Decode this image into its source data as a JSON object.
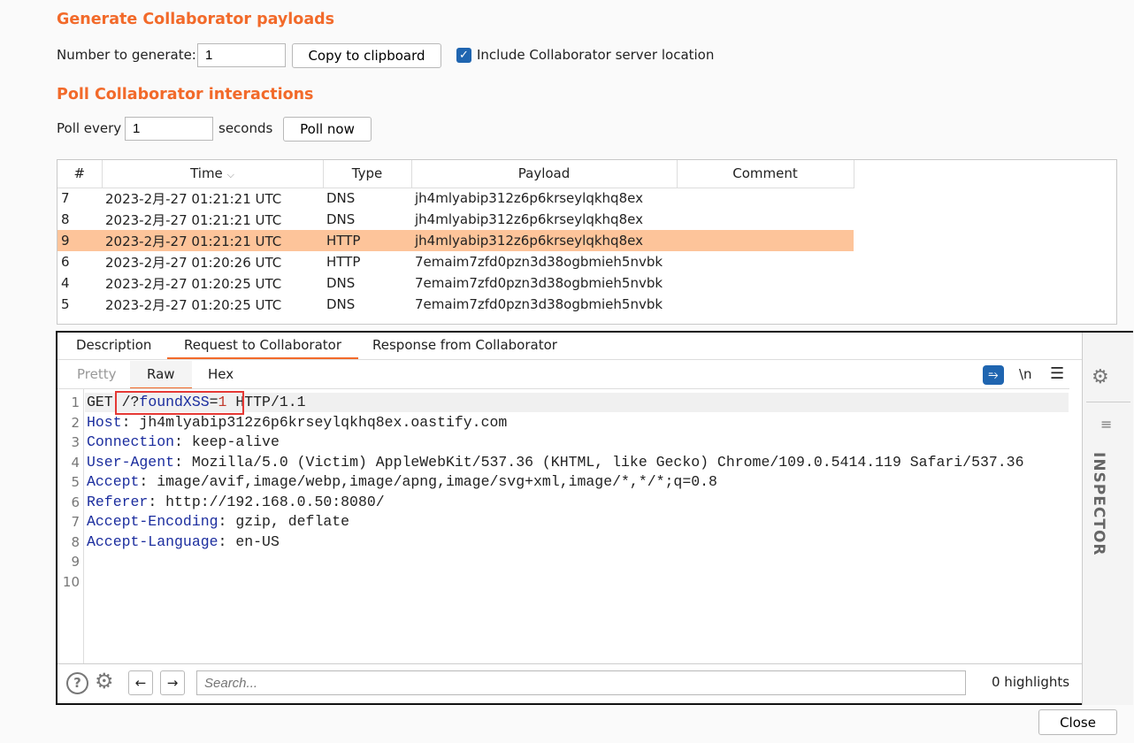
{
  "generate": {
    "title": "Generate Collaborator payloads",
    "number_label": "Number to generate:",
    "number_value": "1",
    "copy_button": "Copy to clipboard",
    "include_label": "Include Collaborator server location",
    "include_checked": true
  },
  "poll": {
    "title": "Poll Collaborator interactions",
    "every_label": "Poll every",
    "every_value": "1",
    "seconds_label": "seconds",
    "poll_now": "Poll now"
  },
  "table": {
    "columns": [
      "#",
      "Time",
      "Type",
      "Payload",
      "Comment"
    ],
    "sort_indicator": "chevron-down-icon",
    "rows": [
      {
        "num": "7",
        "time": "2023-2月-27 01:21:21 UTC",
        "type": "DNS",
        "payload": "jh4mlyabip312z6p6krseylqkhq8ex",
        "comment": "",
        "selected": false
      },
      {
        "num": "8",
        "time": "2023-2月-27 01:21:21 UTC",
        "type": "DNS",
        "payload": "jh4mlyabip312z6p6krseylqkhq8ex",
        "comment": "",
        "selected": false
      },
      {
        "num": "9",
        "time": "2023-2月-27 01:21:21 UTC",
        "type": "HTTP",
        "payload": "jh4mlyabip312z6p6krseylqkhq8ex",
        "comment": "",
        "selected": true
      },
      {
        "num": "6",
        "time": "2023-2月-27 01:20:26 UTC",
        "type": "HTTP",
        "payload": "7emaim7zfd0pzn3d38ogbmieh5nvbk",
        "comment": "",
        "selected": false
      },
      {
        "num": "4",
        "time": "2023-2月-27 01:20:25 UTC",
        "type": "DNS",
        "payload": "7emaim7zfd0pzn3d38ogbmieh5nvbk",
        "comment": "",
        "selected": false
      },
      {
        "num": "5",
        "time": "2023-2月-27 01:20:25 UTC",
        "type": "DNS",
        "payload": "7emaim7zfd0pzn3d38ogbmieh5nvbk",
        "comment": "",
        "selected": false
      }
    ]
  },
  "tabs": [
    "Description",
    "Request to Collaborator",
    "Response from Collaborator"
  ],
  "active_tab": "Request to Collaborator",
  "subtabs": [
    "Pretty",
    "Raw",
    "Hex"
  ],
  "active_subtab": "Raw",
  "toolbar": {
    "newline_label": "\\n"
  },
  "request": {
    "lines": [
      {
        "n": "1",
        "parts": [
          [
            "GET ",
            ""
          ],
          [
            "/?",
            ""
          ],
          [
            "foundXSS",
            "k"
          ],
          [
            "=",
            ""
          ],
          [
            "1",
            "r"
          ],
          [
            " HTTP/1.1",
            ""
          ]
        ]
      },
      {
        "n": "2",
        "parts": [
          [
            "Host",
            "k"
          ],
          [
            ": jh4mlyabip312z6p6krseylqkhq8ex.oastify.com",
            ""
          ]
        ]
      },
      {
        "n": "3",
        "parts": [
          [
            "Connection",
            "k"
          ],
          [
            ": keep-alive",
            ""
          ]
        ]
      },
      {
        "n": "4",
        "parts": [
          [
            "User-Agent",
            "k"
          ],
          [
            ": Mozilla/5.0 (Victim) AppleWebKit/537.36 (KHTML, like Gecko) Chrome/109.0.5414.119 Safari/537.36",
            ""
          ]
        ]
      },
      {
        "n": "5",
        "parts": [
          [
            "Accept",
            "k"
          ],
          [
            ": image/avif,image/webp,image/apng,image/svg+xml,image/*,*/*;q=0.8",
            ""
          ]
        ]
      },
      {
        "n": "6",
        "parts": [
          [
            "Referer",
            "k"
          ],
          [
            ": http://192.168.0.50:8080/",
            ""
          ]
        ]
      },
      {
        "n": "7",
        "parts": [
          [
            "Accept-Encoding",
            "k"
          ],
          [
            ": gzip, deflate",
            ""
          ]
        ]
      },
      {
        "n": "8",
        "parts": [
          [
            "Accept-Language",
            "k"
          ],
          [
            ": en-US",
            ""
          ]
        ]
      },
      {
        "n": "9",
        "parts": []
      },
      {
        "n": "10",
        "parts": []
      }
    ]
  },
  "inspector_label": "INSPECTOR",
  "search": {
    "placeholder": "Search...",
    "highlights": "0 highlights"
  },
  "close_button": "Close",
  "colors": {
    "accent": "#f26a2a",
    "selected_row": "#fdc49a",
    "highlight_box": "#e53935",
    "keyword": "#1b2d9e"
  }
}
